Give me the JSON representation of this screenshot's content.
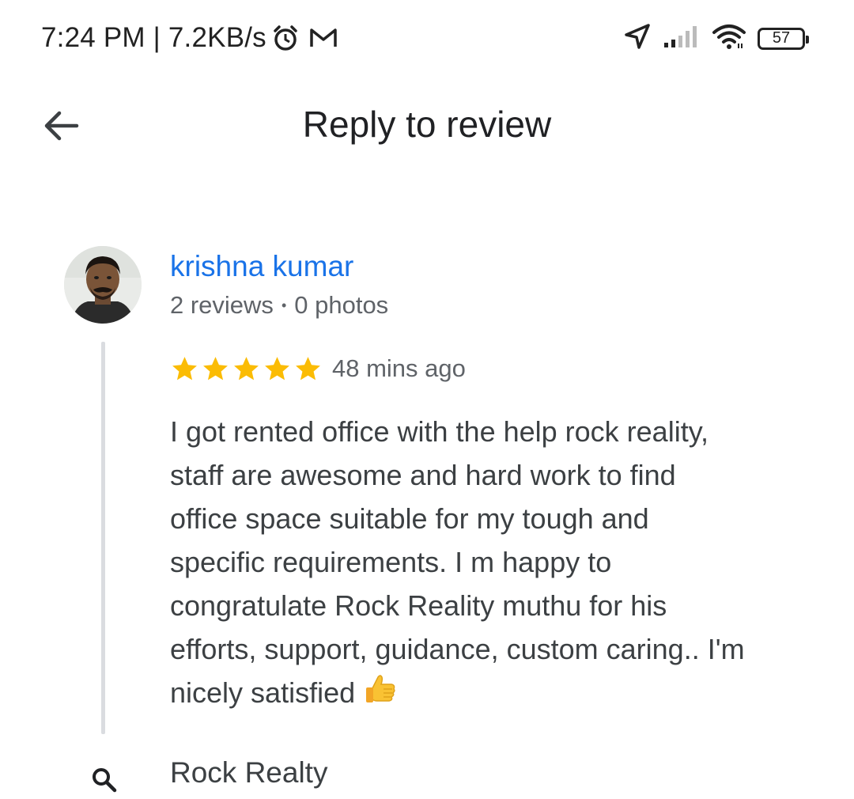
{
  "status_bar": {
    "time": "7:24 PM",
    "separator": " | ",
    "network_speed": "7.2KB/s",
    "battery_level": "57",
    "icons": [
      "alarm-icon",
      "gmail-icon",
      "location-arrow-icon",
      "signal-icon",
      "wifi-icon",
      "battery-icon"
    ]
  },
  "app_bar": {
    "title": "Reply to review",
    "back_icon": "arrow-back-icon"
  },
  "review": {
    "reviewer_name": "krishna kumar",
    "reviews_count": "2 reviews",
    "dot": "•",
    "photos_count": "0 photos",
    "rating": 5,
    "rating_max": 5,
    "time_ago": "48 mins ago",
    "text": "I got rented office with the help rock reality,\nstaff are awesome and hard work to find\noffice space suitable for my tough and\nspecific requirements. I m happy to\ncongratulate Rock Reality muthu for his\nefforts, support, guidance, custom caring.. I'm\nnicely satisfied",
    "emoji_icon": "thumbs-up-icon"
  },
  "business": {
    "name": "Rock Realty",
    "icon": "search-icon"
  },
  "colors": {
    "name_link": "#1a73e8",
    "star": "#fbbc04",
    "secondary_text": "#5f6368",
    "thread_line": "#dadce0"
  }
}
